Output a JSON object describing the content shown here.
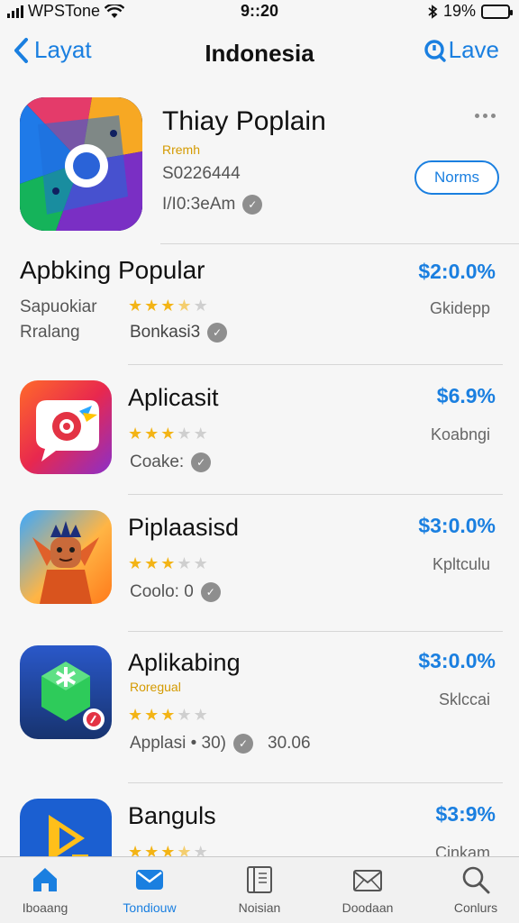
{
  "status": {
    "carrier": "WPSTone",
    "time": "9::20",
    "battery": "19%"
  },
  "nav": {
    "back_label": "Layat",
    "title": "Indonesia",
    "right_label": "Lave"
  },
  "hero": {
    "title": "Thiay Poplain",
    "subtitle": "Rremh",
    "code": "S0226444",
    "time": "I/I0:3eAm",
    "button_label": "Norms"
  },
  "section": {
    "title": "Apbking Popular",
    "price": "$2:0.0%",
    "line1": "Sapuokiar",
    "line2": "Rralang",
    "rating": 3.5,
    "meta": "Bonkasi3",
    "right_text": "Gkidepp"
  },
  "apps": [
    {
      "title": "Aplicasit",
      "price": "$6.9%",
      "subtitle": "",
      "rating": 3,
      "meta": "Coake:",
      "right_text": "Koabngi",
      "meta_extra": ""
    },
    {
      "title": "Piplaasisd",
      "price": "$3:0.0%",
      "subtitle": "",
      "rating": 3,
      "meta": "Coolo: 0",
      "right_text": "Kpltculu",
      "meta_extra": ""
    },
    {
      "title": "Aplikabing",
      "price": "$3:0.0%",
      "subtitle": "Roregual",
      "rating": 3,
      "meta": "Applasi • 30)",
      "right_text": "Sklccai",
      "meta_extra": "30.06"
    },
    {
      "title": "Banguls",
      "price": "$3:9%",
      "subtitle": "",
      "rating": 3.5,
      "meta": "",
      "right_text": "Cinkam",
      "meta_extra": ""
    }
  ],
  "tabs": [
    {
      "label": "Iboaang",
      "icon": "home-icon"
    },
    {
      "label": "Tondiouw",
      "icon": "mail-icon"
    },
    {
      "label": "Noisian",
      "icon": "notebook-icon"
    },
    {
      "label": "Doodaan",
      "icon": "envelope-icon"
    },
    {
      "label": "Conlurs",
      "icon": "search-icon"
    }
  ],
  "colors": {
    "accent": "#1a7fe0",
    "star": "#f3b416"
  }
}
